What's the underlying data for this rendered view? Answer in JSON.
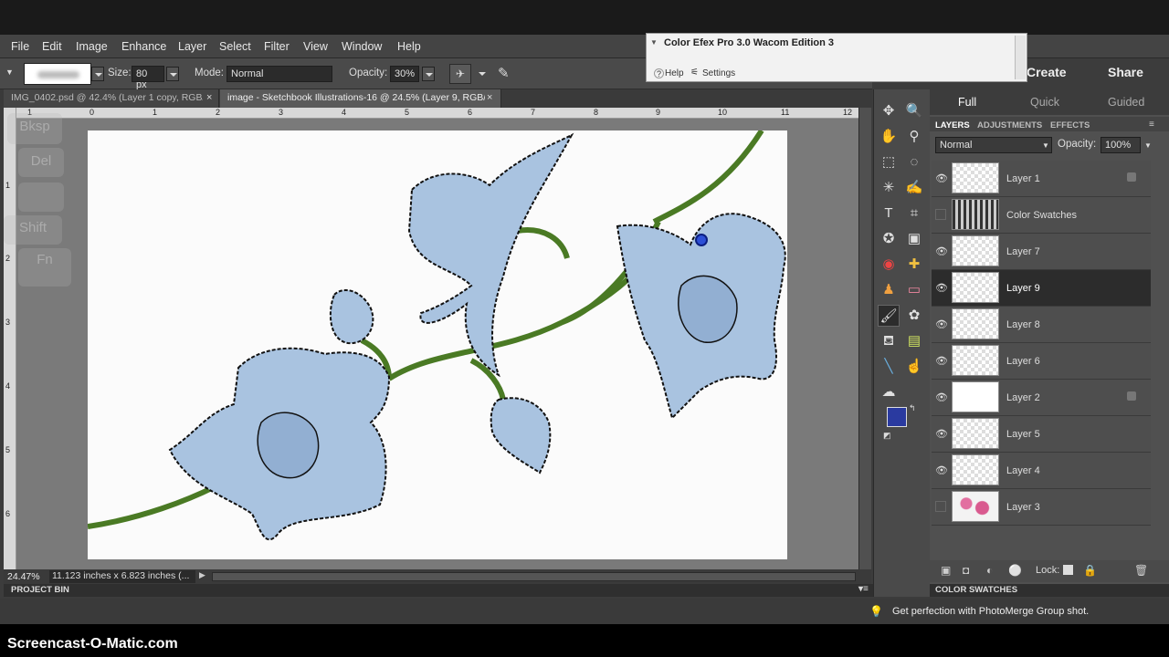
{
  "menu": [
    "File",
    "Edit",
    "Image",
    "Enhance",
    "Layer",
    "Select",
    "Filter",
    "View",
    "Window",
    "Help"
  ],
  "top_buttons": {
    "create": "Create",
    "share": "Share"
  },
  "options": {
    "size_label": "Size:",
    "size_value": "80 px",
    "mode_label": "Mode:",
    "mode_value": "Normal",
    "opacity_label": "Opacity:",
    "opacity_value": "30%"
  },
  "tabs": [
    {
      "label": "IMG_0402.psd @ 42.4% (Layer 1 copy, RGB/8) *"
    },
    {
      "label": "image - Sketchbook Illustrations-16 @ 24.5% (Layer 9, RGB/8) *"
    }
  ],
  "ruler": {
    "h": [
      "1",
      "0",
      "1",
      "2",
      "3",
      "4",
      "5",
      "6",
      "7",
      "8",
      "9",
      "10",
      "11",
      "12"
    ],
    "v": [
      "1",
      "2",
      "3",
      "4",
      "5",
      "6"
    ]
  },
  "status": {
    "zoom": "24.47%",
    "dimensions": "11.123 inches x 6.823 inches (..."
  },
  "project_bin": "PROJECT BIN",
  "color_swatches": "COLOR SWATCHES",
  "hint": "Get perfection with PhotoMerge Group shot.",
  "mode_tabs": [
    "Full",
    "Quick",
    "Guided"
  ],
  "panel_tabs": [
    "LAYERS",
    "ADJUSTMENTS",
    "EFFECTS"
  ],
  "layers_panel": {
    "blend": "Normal",
    "opacity_label": "Opacity:",
    "opacity_value": "100%",
    "lock_label": "Lock:"
  },
  "layers": [
    {
      "name": "Layer 1",
      "visible": true,
      "locked": true
    },
    {
      "name": "Color Swatches",
      "visible": false,
      "locked": false
    },
    {
      "name": "Layer 7",
      "visible": true,
      "locked": false
    },
    {
      "name": "Layer 9",
      "visible": true,
      "locked": false,
      "selected": true
    },
    {
      "name": "Layer 8",
      "visible": true,
      "locked": false
    },
    {
      "name": "Layer 6",
      "visible": true,
      "locked": false
    },
    {
      "name": "Layer 2",
      "visible": true,
      "locked": true
    },
    {
      "name": "Layer 5",
      "visible": true,
      "locked": false
    },
    {
      "name": "Layer 4",
      "visible": true,
      "locked": false
    },
    {
      "name": "Layer 3",
      "visible": false,
      "locked": false
    }
  ],
  "efex": {
    "title": "Color Efex Pro 3.0 Wacom Edition 3",
    "help": "Help",
    "settings": "Settings"
  },
  "keys": [
    "Bksp",
    "Del",
    "Shift",
    "Fn"
  ],
  "watermark": "Screencast-O-Matic.com",
  "colors": {
    "foreground": "#2a3aa0",
    "background": "#1a88b0",
    "petal": "#a9c3e0",
    "stem": "#4a7a24"
  }
}
